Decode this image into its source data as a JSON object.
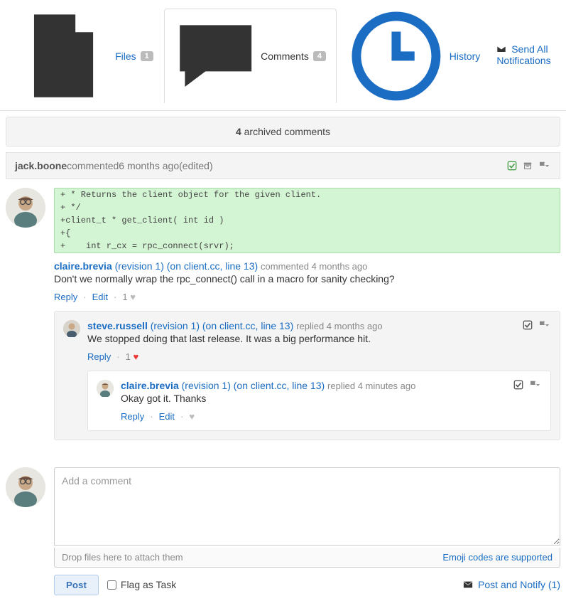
{
  "tabs": {
    "files": {
      "label": "Files",
      "count": "1"
    },
    "comments": {
      "label": "Comments",
      "count": "4"
    },
    "history": {
      "label": "History"
    }
  },
  "send_all": "Send All Notifications",
  "banner": {
    "count": "4",
    "text": " archived comments"
  },
  "thread": {
    "author": "jack.boone",
    "verb": " commented ",
    "time": "6 months ago",
    "edited": " (edited)"
  },
  "code": {
    "lines": [
      "+ * Returns the client object for the given client.",
      "+ */",
      "+client_t * get_client( int id )",
      "+{",
      "+    int r_cx = rpc_connect(srvr);"
    ]
  },
  "c1": {
    "name": "claire.brevia",
    "rev": " (revision 1) (on client.cc, line 13)",
    "verb": " commented ",
    "time": "4 months ago",
    "body": "Don't we normally wrap the rpc_connect() call in a macro for sanity checking?",
    "reply": "Reply",
    "edit": "Edit",
    "likes": "1 "
  },
  "c2": {
    "name": "steve.russell",
    "rev": " (revision 1) (on client.cc, line 13)",
    "verb": " replied ",
    "time": "4 months ago",
    "body": "We stopped doing that last release. It was a big performance hit.",
    "reply": "Reply",
    "likes": "1 "
  },
  "c3": {
    "name": "claire.brevia",
    "rev": " (revision 1) (on client.cc, line 13)",
    "verb": " replied ",
    "time": "4 minutes ago",
    "body": "Okay got it. Thanks",
    "reply": "Reply",
    "edit": "Edit"
  },
  "composer": {
    "placeholder": "Add a comment",
    "drop": "Drop files here to attach them",
    "emoji": "Emoji codes are supported",
    "post": "Post",
    "flag": "Flag as Task",
    "notify": "Post and Notify (1)"
  }
}
